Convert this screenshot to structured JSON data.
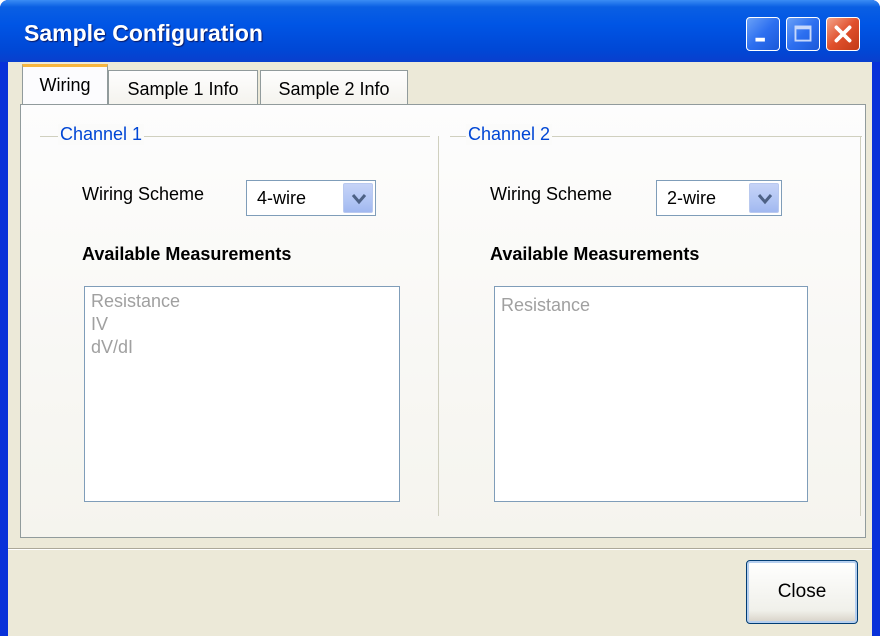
{
  "window": {
    "title": "Sample Configuration"
  },
  "tabs": [
    {
      "label": "Wiring",
      "active": true
    },
    {
      "label": "Sample 1 Info",
      "active": false
    },
    {
      "label": "Sample 2 Info",
      "active": false
    }
  ],
  "channel1": {
    "title": "Channel 1",
    "wiring_label": "Wiring Scheme",
    "wiring_value": "4-wire",
    "measurements_heading": "Available Measurements",
    "measurements": [
      "Resistance",
      "IV",
      "dV/dI"
    ]
  },
  "channel2": {
    "title": "Channel 2",
    "wiring_label": "Wiring Scheme",
    "wiring_value": "2-wire",
    "measurements_heading": "Available Measurements",
    "measurements": [
      "Resistance"
    ]
  },
  "footer": {
    "close_label": "Close"
  },
  "colors": {
    "titlebar": "#0055e5",
    "group_title": "#0046d5",
    "disabled_text": "#a0a0a0"
  }
}
